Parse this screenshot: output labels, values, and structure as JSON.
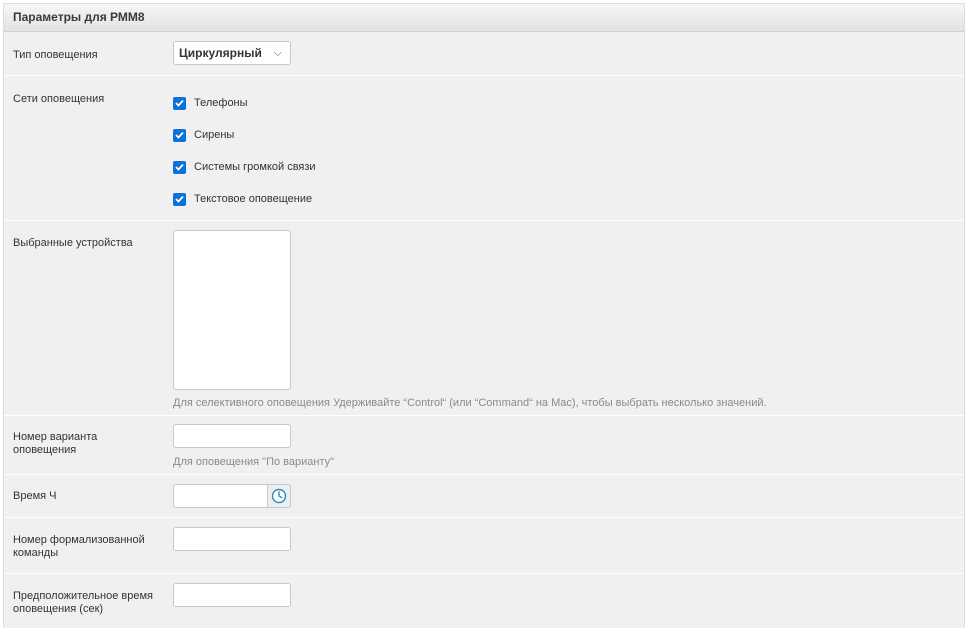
{
  "header": {
    "title": "Параметры для РММ8"
  },
  "notification_type": {
    "label": "Тип оповещения",
    "value": "Циркулярный"
  },
  "networks": {
    "label": "Сети оповещения",
    "items": [
      {
        "label": "Телефоны",
        "checked": true
      },
      {
        "label": "Сирены",
        "checked": true
      },
      {
        "label": "Системы громкой связи",
        "checked": true
      },
      {
        "label": "Текстовое оповещение",
        "checked": true
      }
    ]
  },
  "devices": {
    "label": "Выбранные устройства",
    "help": "Для селективного оповещения Удерживайте “Control“ (или “Command“ на Mac), чтобы выбрать несколько значений."
  },
  "variant_number": {
    "label_line1": "Номер варианта",
    "label_line2": "оповещения",
    "value": "",
    "help": "Для оповещения \"По варианту\""
  },
  "time_h": {
    "label": "Время Ч",
    "value": ""
  },
  "formal_command": {
    "label_line1": "Номер формализованной",
    "label_line2": "команды",
    "value": ""
  },
  "estimated_time": {
    "label_line1": "Предположительное время",
    "label_line2": "оповещения (сек)",
    "value": ""
  },
  "colors": {
    "accent": "#0b72d8",
    "row_bg": "#f0f0f0",
    "help_text": "#8a8a8a"
  }
}
